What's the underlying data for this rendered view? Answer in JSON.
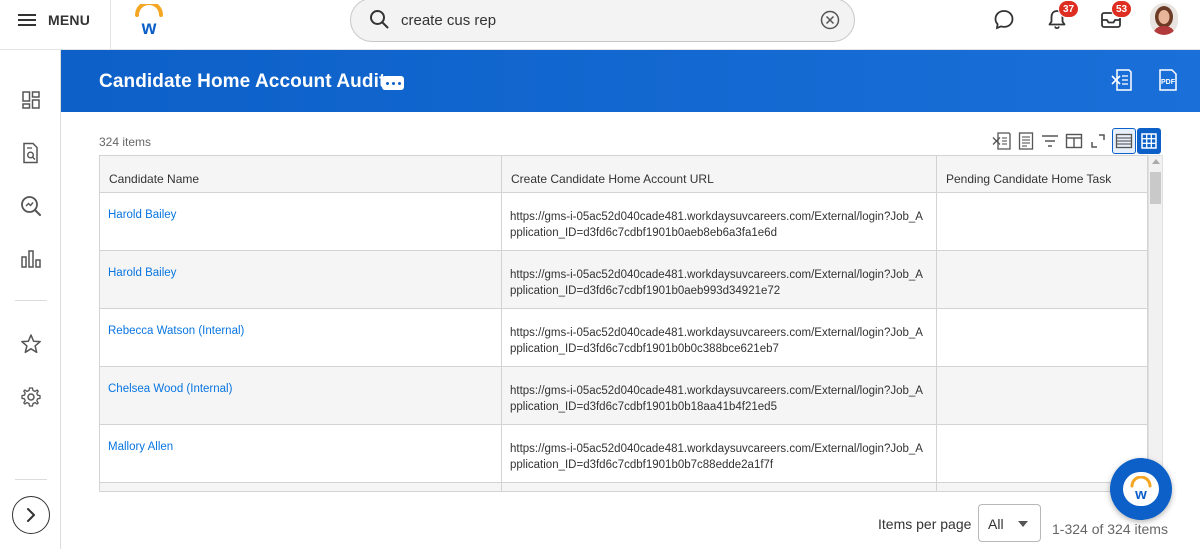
{
  "topbar": {
    "menu_label": "MENU",
    "search": {
      "value": "create cus rep",
      "placeholder": ""
    },
    "notifications_count": "37",
    "inbox_count": "53"
  },
  "header": {
    "title": "Candidate Home Account Audit"
  },
  "grid": {
    "item_count": "324 items",
    "columns": [
      "Candidate Name",
      "Create Candidate Home Account URL",
      "Pending Candidate Home Task"
    ],
    "rows": [
      {
        "name": "Harold Bailey",
        "url": "https://gms-i-05ac52d040cade481.workdaysuvcareers.com/External/login?Job_Application_ID=d3fd6c7cdbf1901b0aeb8eb6a3fa1e6d",
        "task": ""
      },
      {
        "name": "Harold Bailey",
        "url": "https://gms-i-05ac52d040cade481.workdaysuvcareers.com/External/login?Job_Application_ID=d3fd6c7cdbf1901b0aeb993d34921e72",
        "task": ""
      },
      {
        "name": "Rebecca Watson (Internal)",
        "url": "https://gms-i-05ac52d040cade481.workdaysuvcareers.com/External/login?Job_Application_ID=d3fd6c7cdbf1901b0b0c388bce621eb7",
        "task": ""
      },
      {
        "name": "Chelsea Wood (Internal)",
        "url": "https://gms-i-05ac52d040cade481.workdaysuvcareers.com/External/login?Job_Application_ID=d3fd6c7cdbf1901b0b18aa41b4f21ed5",
        "task": ""
      },
      {
        "name": "Mallory Allen",
        "url": "https://gms-i-05ac52d040cade481.workdaysuvcareers.com/External/login?Job_Application_ID=d3fd6c7cdbf1901b0b7c88edde2a1f7f",
        "task": ""
      }
    ]
  },
  "pagination": {
    "items_per_page_label": "Items per page",
    "items_per_page_value": "All",
    "range_text": "1-324 of 324 items"
  },
  "colors": {
    "brand_blue": "#0c60c8",
    "link_blue": "#0875e1",
    "badge_red": "#de2e21",
    "logo_orange": "#f5a623"
  },
  "icons": {
    "rail": [
      "dashboard-icon",
      "report-search-icon",
      "search-analytics-icon",
      "bar-chart-icon",
      "star-icon",
      "settings-gear-icon"
    ],
    "toolbar": [
      "export-excel-icon",
      "print-icon",
      "filter-icon",
      "columns-icon",
      "fullscreen-icon",
      "table-view-icon",
      "grid-view-icon"
    ]
  }
}
